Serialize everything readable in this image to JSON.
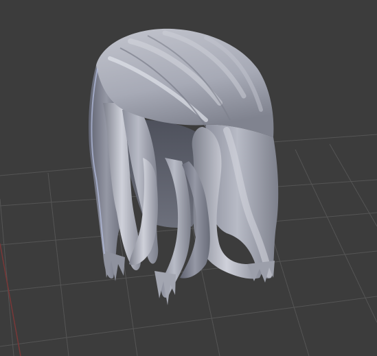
{
  "viewport": {
    "background_color": "#3c3c3c",
    "grid_color": "#555555",
    "axis_x_color": "#7a3838",
    "axis_y_color": "#5b7a3a",
    "model": {
      "type": "3d-hair-mesh",
      "base_color": "#9da0ab",
      "highlight_color": "#d8dae2",
      "shadow_color": "#6e717c",
      "rim_color": "#aab5d8"
    }
  }
}
